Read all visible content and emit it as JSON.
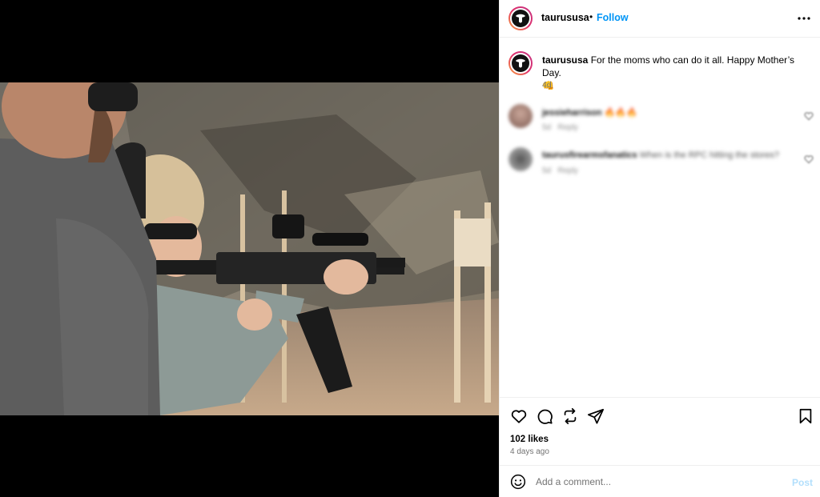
{
  "post": {
    "username": "taurususa",
    "separator": "•",
    "follow_label": "Follow",
    "more_icon": "more-horizontal-icon"
  },
  "caption": {
    "username": "taurususa",
    "text": "For the moms who can do it all. Happy Mother’s Day.",
    "emoji": "👊",
    "time": "4d"
  },
  "comments": [
    {
      "username": "jessieharrison",
      "text": "🔥🔥🔥",
      "time": "5d",
      "reply_label": "Reply"
    },
    {
      "username": "taurusfirearmsfanatics",
      "text": "When is the RPC hitting the stores?",
      "time": "5d",
      "reply_label": "Reply"
    }
  ],
  "actions": {
    "icons": [
      "heart-icon",
      "comment-icon",
      "repost-icon",
      "share-icon",
      "bookmark-icon"
    ],
    "likes": "102 likes",
    "time_ago": "4 days ago"
  },
  "add_comment": {
    "placeholder": "Add a comment...",
    "post_label": "Post",
    "emoji_icon": "emoji-icon"
  },
  "colors": {
    "accent": "#0095f6",
    "post_disabled": "#b2dffc",
    "muted": "#737373"
  }
}
